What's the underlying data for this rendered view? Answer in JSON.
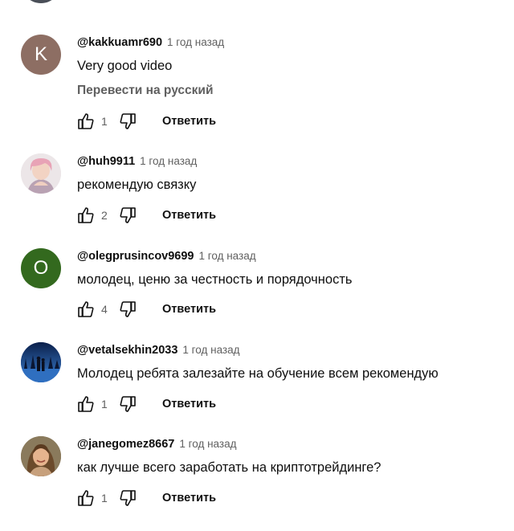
{
  "comments": [
    {
      "author": "@kakkuamr690",
      "time": "1 год назад",
      "text": "Very good video",
      "translate_label": "Перевести на русский",
      "avatar_letter": "K",
      "avatar_color": "#8d6e63",
      "likes": "1",
      "reply_label": "Ответить"
    },
    {
      "author": "@huh9911",
      "time": "1 год назад",
      "text": "рекомендую связку",
      "likes": "2",
      "reply_label": "Ответить"
    },
    {
      "author": "@olegprusincov9699",
      "time": "1 год назад",
      "text": "молодец, ценю за честность и порядочность",
      "avatar_letter": "O",
      "avatar_color": "#33691e",
      "likes": "4",
      "reply_label": "Ответить"
    },
    {
      "author": "@vetalsekhin2033",
      "time": "1 год назад",
      "text": "Молодец ребята залезайте на обучение всем рекомендую",
      "likes": "1",
      "reply_label": "Ответить"
    },
    {
      "author": "@janegomez8667",
      "time": "1 год назад",
      "text": "как лучше всего заработать на криптотрейдинге?",
      "likes": "1",
      "reply_label": "Ответить"
    }
  ],
  "icons": {
    "like": "thumb-up-icon",
    "dislike": "thumb-down-icon"
  }
}
